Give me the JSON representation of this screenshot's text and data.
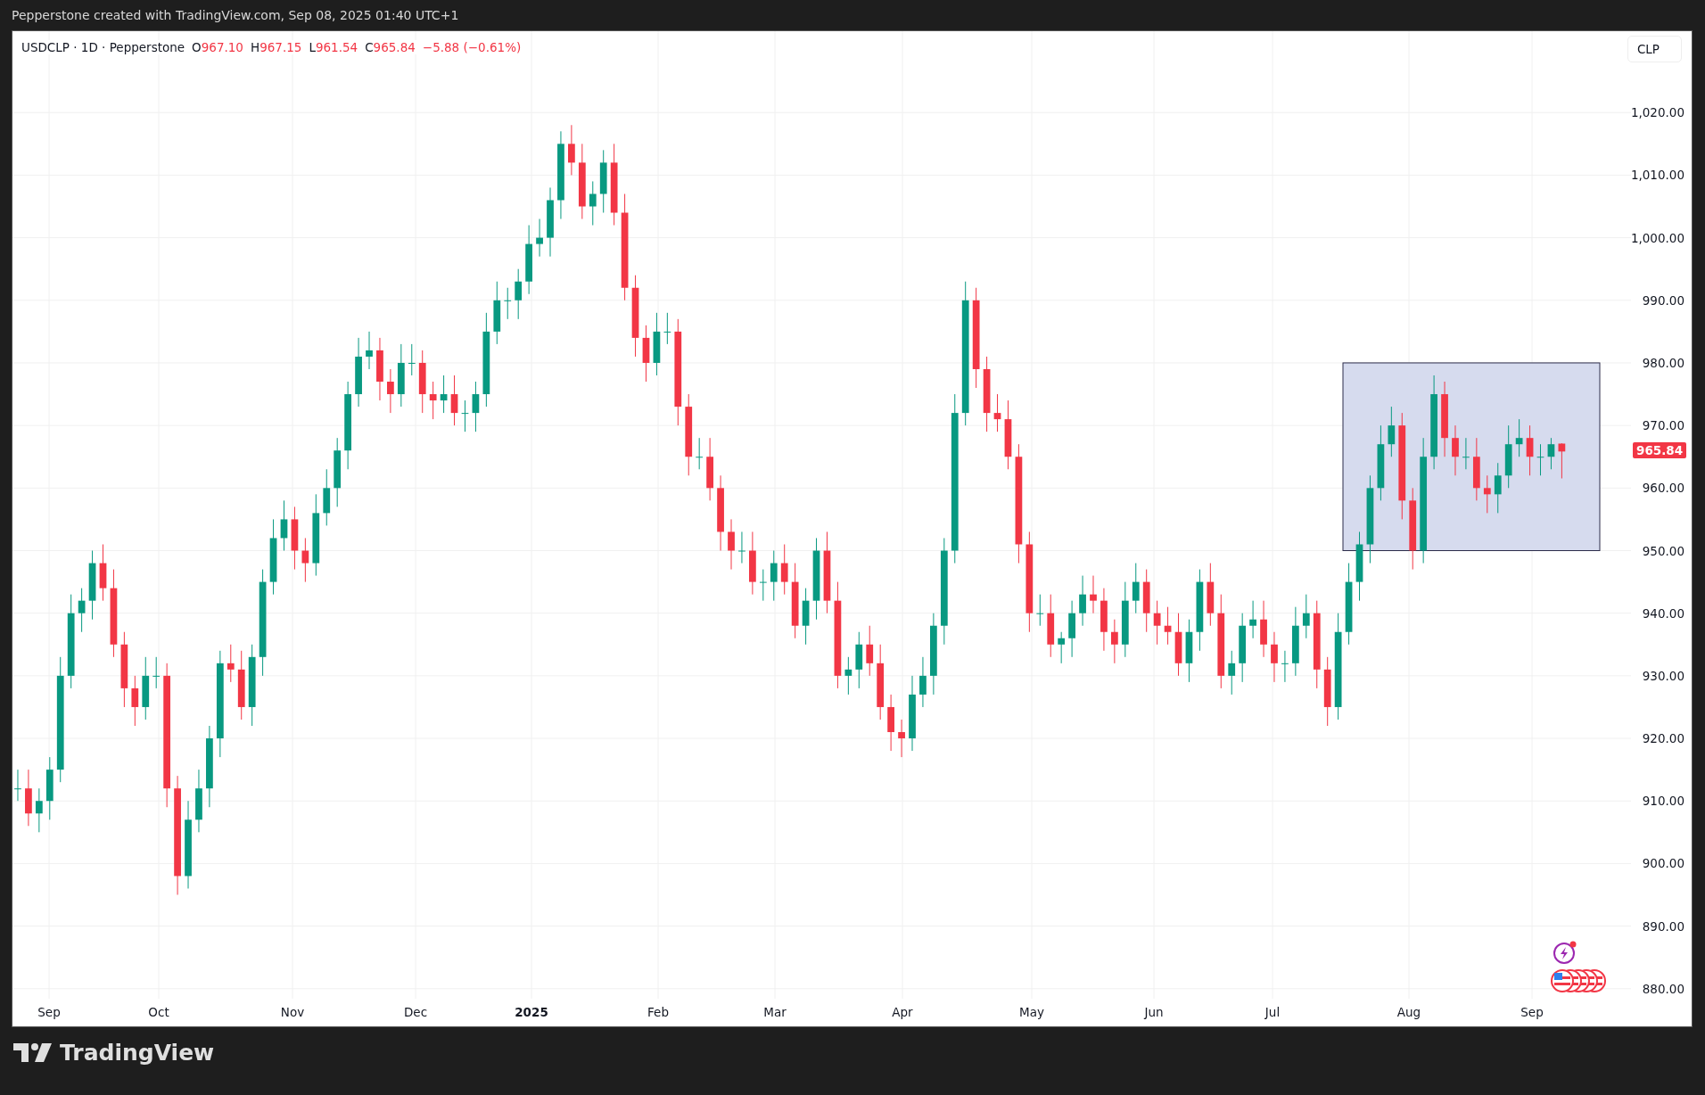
{
  "header": {
    "text": "Pepperstone created with TradingView.com, Sep 08, 2025 01:40 UTC+1"
  },
  "legend": {
    "symbol": "USDCLP · 1D · Pepperstone",
    "ohlc": [
      {
        "label": "O",
        "value": "967.10"
      },
      {
        "label": "H",
        "value": "967.15"
      },
      {
        "label": "L",
        "value": "961.54"
      },
      {
        "label": "C",
        "value": "965.84"
      }
    ],
    "change": "−5.88 (−0.61%)"
  },
  "currency_button": "CLP",
  "last_price": "965.84",
  "chart_data": {
    "type": "candlestick",
    "categories": [
      null,
      null,
      null,
      null,
      null,
      null,
      null,
      null,
      null,
      null,
      null,
      null,
      null,
      null,
      null,
      null,
      null,
      null,
      null,
      null,
      null,
      null,
      null,
      null,
      null,
      null,
      null,
      null,
      null,
      null,
      null,
      null,
      null,
      null,
      null,
      null,
      null,
      null,
      null,
      null,
      null,
      null,
      null,
      null,
      null,
      null,
      null,
      null,
      null,
      null,
      null,
      null,
      null,
      null,
      null,
      null,
      null,
      null,
      null,
      null,
      null,
      null,
      null,
      null,
      null,
      null,
      null,
      null,
      null,
      null,
      null,
      null,
      null,
      null,
      null,
      null,
      null,
      null,
      null,
      null,
      null,
      null,
      null,
      null,
      null,
      null,
      null,
      null,
      null,
      null,
      null,
      null,
      null,
      null,
      null,
      null,
      null,
      null,
      null,
      null,
      null,
      null,
      null,
      null,
      null,
      null,
      null,
      null,
      null,
      null,
      null,
      null,
      null,
      null,
      null,
      null,
      null,
      null,
      null,
      null,
      null,
      null,
      null,
      null,
      null,
      null,
      null,
      null,
      null,
      null,
      null,
      null,
      null,
      null,
      null,
      null,
      null,
      null,
      null,
      null,
      null,
      null,
      null,
      null,
      null,
      null,
      null,
      null,
      null,
      null,
      null,
      null
    ],
    "ohlc": [
      [
        912,
        915,
        910,
        912
      ],
      [
        912,
        915,
        906,
        908
      ],
      [
        908,
        912,
        905,
        910
      ],
      [
        910,
        917,
        907,
        915
      ],
      [
        915,
        933,
        913,
        930
      ],
      [
        930,
        943,
        928,
        940
      ],
      [
        940,
        944,
        937,
        942
      ],
      [
        942,
        950,
        939,
        948
      ],
      [
        948,
        951,
        942,
        944
      ],
      [
        944,
        947,
        933,
        935
      ],
      [
        935,
        937,
        925,
        928
      ],
      [
        928,
        930,
        922,
        925
      ],
      [
        925,
        933,
        923,
        930
      ],
      [
        930,
        933,
        928,
        930
      ],
      [
        930,
        932,
        909,
        912
      ],
      [
        912,
        914,
        895,
        898
      ],
      [
        898,
        910,
        896,
        907
      ],
      [
        907,
        915,
        905,
        912
      ],
      [
        912,
        922,
        909,
        920
      ],
      [
        920,
        934,
        917,
        932
      ],
      [
        932,
        935,
        929,
        931
      ],
      [
        931,
        934,
        923,
        925
      ],
      [
        925,
        935,
        922,
        933
      ],
      [
        933,
        947,
        930,
        945
      ],
      [
        945,
        955,
        943,
        952
      ],
      [
        952,
        958,
        950,
        955
      ],
      [
        955,
        957,
        947,
        950
      ],
      [
        950,
        952,
        945,
        948
      ],
      [
        948,
        959,
        946,
        956
      ],
      [
        956,
        963,
        954,
        960
      ],
      [
        960,
        968,
        957,
        966
      ],
      [
        966,
        977,
        963,
        975
      ],
      [
        975,
        984,
        973,
        981
      ],
      [
        981,
        985,
        979,
        982
      ],
      [
        982,
        984,
        974,
        977
      ],
      [
        977,
        979,
        972,
        975
      ],
      [
        975,
        983,
        973,
        980
      ],
      [
        980,
        983,
        978,
        980
      ],
      [
        980,
        982,
        972,
        975
      ],
      [
        975,
        977,
        971,
        974
      ],
      [
        974,
        978,
        972,
        975
      ],
      [
        975,
        978,
        970,
        972
      ],
      [
        972,
        974,
        969,
        972
      ],
      [
        972,
        977,
        969,
        975
      ],
      [
        975,
        988,
        973,
        985
      ],
      [
        985,
        993,
        983,
        990
      ],
      [
        990,
        992,
        987,
        990
      ],
      [
        990,
        995,
        987,
        993
      ],
      [
        993,
        1002,
        991,
        999
      ],
      [
        999,
        1003,
        997,
        1000
      ],
      [
        1000,
        1008,
        997,
        1006
      ],
      [
        1006,
        1017,
        1003,
        1015
      ],
      [
        1015,
        1018,
        1010,
        1012
      ],
      [
        1012,
        1015,
        1003,
        1005
      ],
      [
        1005,
        1009,
        1002,
        1007
      ],
      [
        1007,
        1014,
        1004,
        1012
      ],
      [
        1012,
        1015,
        1002,
        1004
      ],
      [
        1004,
        1007,
        990,
        992
      ],
      [
        992,
        994,
        981,
        984
      ],
      [
        984,
        986,
        977,
        980
      ],
      [
        980,
        988,
        978,
        985
      ],
      [
        985,
        988,
        983,
        985
      ],
      [
        985,
        987,
        970,
        973
      ],
      [
        973,
        975,
        962,
        965
      ],
      [
        965,
        968,
        963,
        965
      ],
      [
        965,
        968,
        958,
        960
      ],
      [
        960,
        962,
        950,
        953
      ],
      [
        953,
        955,
        947,
        950
      ],
      [
        950,
        953,
        948,
        950
      ],
      [
        950,
        953,
        943,
        945
      ],
      [
        945,
        947,
        942,
        945
      ],
      [
        945,
        950,
        942,
        948
      ],
      [
        948,
        951,
        943,
        945
      ],
      [
        945,
        948,
        936,
        938
      ],
      [
        938,
        944,
        935,
        942
      ],
      [
        942,
        952,
        939,
        950
      ],
      [
        950,
        953,
        940,
        942
      ],
      [
        942,
        945,
        928,
        930
      ],
      [
        930,
        933,
        927,
        931
      ],
      [
        931,
        937,
        928,
        935
      ],
      [
        935,
        938,
        930,
        932
      ],
      [
        932,
        935,
        923,
        925
      ],
      [
        925,
        927,
        918,
        921
      ],
      [
        921,
        923,
        917,
        920
      ],
      [
        920,
        930,
        918,
        927
      ],
      [
        927,
        933,
        925,
        930
      ],
      [
        930,
        940,
        927,
        938
      ],
      [
        938,
        952,
        935,
        950
      ],
      [
        950,
        975,
        948,
        972
      ],
      [
        972,
        993,
        970,
        990
      ],
      [
        990,
        992,
        976,
        979
      ],
      [
        979,
        981,
        969,
        972
      ],
      [
        972,
        975,
        969,
        971
      ],
      [
        971,
        974,
        963,
        965
      ],
      [
        965,
        967,
        948,
        951
      ],
      [
        951,
        953,
        937,
        940
      ],
      [
        940,
        943,
        938,
        940
      ],
      [
        940,
        943,
        933,
        935
      ],
      [
        935,
        937,
        932,
        936
      ],
      [
        936,
        942,
        933,
        940
      ],
      [
        940,
        946,
        938,
        943
      ],
      [
        943,
        946,
        940,
        942
      ],
      [
        942,
        944,
        934,
        937
      ],
      [
        937,
        939,
        932,
        935
      ],
      [
        935,
        945,
        933,
        942
      ],
      [
        942,
        948,
        940,
        945
      ],
      [
        945,
        947,
        937,
        940
      ],
      [
        940,
        942,
        935,
        938
      ],
      [
        938,
        941,
        935,
        937
      ],
      [
        937,
        940,
        930,
        932
      ],
      [
        932,
        939,
        929,
        937
      ],
      [
        937,
        947,
        934,
        945
      ],
      [
        945,
        948,
        938,
        940
      ],
      [
        940,
        943,
        928,
        930
      ],
      [
        930,
        934,
        927,
        932
      ],
      [
        932,
        940,
        929,
        938
      ],
      [
        938,
        942,
        936,
        939
      ],
      [
        939,
        942,
        933,
        935
      ],
      [
        935,
        937,
        929,
        932
      ],
      [
        932,
        934,
        929,
        932
      ],
      [
        932,
        941,
        930,
        938
      ],
      [
        938,
        943,
        936,
        940
      ],
      [
        940,
        942,
        928,
        931
      ],
      [
        931,
        933,
        922,
        925
      ],
      [
        925,
        940,
        923,
        937
      ],
      [
        937,
        948,
        935,
        945
      ],
      [
        945,
        953,
        942,
        951
      ],
      [
        951,
        962,
        948,
        960
      ],
      [
        960,
        970,
        958,
        967
      ],
      [
        967,
        973,
        965,
        970
      ],
      [
        970,
        972,
        955,
        958
      ],
      [
        958,
        960,
        947,
        950
      ],
      [
        950,
        968,
        948,
        965
      ],
      [
        965,
        978,
        963,
        975
      ],
      [
        975,
        977,
        965,
        968
      ],
      [
        968,
        970,
        962,
        965
      ],
      [
        965,
        968,
        963,
        965
      ],
      [
        965,
        968,
        958,
        960
      ],
      [
        960,
        962,
        956,
        959
      ],
      [
        959,
        964,
        956,
        962
      ],
      [
        962,
        970,
        960,
        967
      ],
      [
        967,
        971,
        965,
        968
      ],
      [
        968,
        970,
        962,
        965
      ],
      [
        965,
        967,
        962,
        965
      ],
      [
        965,
        968,
        963,
        967
      ],
      [
        967.1,
        967.15,
        961.54,
        965.84
      ],
      null,
      null,
      null,
      null,
      null,
      null
    ],
    "ylim": [
      878.4,
      1033
    ],
    "grid": true,
    "yticks": [
      {
        "value": 1020,
        "label": "1,020.00"
      },
      {
        "value": 1010,
        "label": "1,010.00"
      },
      {
        "value": 1000,
        "label": "1,000.00"
      },
      {
        "value": 990,
        "label": "990.00"
      },
      {
        "value": 980,
        "label": "980.00"
      },
      {
        "value": 970,
        "label": "970.00"
      },
      {
        "value": 960,
        "label": "960.00"
      },
      {
        "value": 950,
        "label": "950.00"
      },
      {
        "value": 940,
        "label": "940.00"
      },
      {
        "value": 930,
        "label": "930.00"
      },
      {
        "value": 920,
        "label": "920.00"
      },
      {
        "value": 910,
        "label": "910.00"
      },
      {
        "value": 900,
        "label": "900.00"
      },
      {
        "value": 890,
        "label": "890.00"
      },
      {
        "value": 880,
        "label": "880.00"
      }
    ]
  },
  "time_axis": [
    {
      "label": "Sep",
      "kind": "month"
    },
    {
      "label": "Oct",
      "kind": "month"
    },
    {
      "label": "Nov",
      "kind": "month"
    },
    {
      "label": "Dec",
      "kind": "month"
    },
    {
      "label": "2025",
      "kind": "year"
    },
    {
      "label": "Feb",
      "kind": "month"
    },
    {
      "label": "Mar",
      "kind": "month"
    },
    {
      "label": "Apr",
      "kind": "month"
    },
    {
      "label": "May",
      "kind": "month"
    },
    {
      "label": "Jun",
      "kind": "month"
    },
    {
      "label": "Jul",
      "kind": "month"
    },
    {
      "label": "Aug",
      "kind": "month"
    },
    {
      "label": "Sep",
      "kind": "month"
    }
  ],
  "logo": "TradingView"
}
